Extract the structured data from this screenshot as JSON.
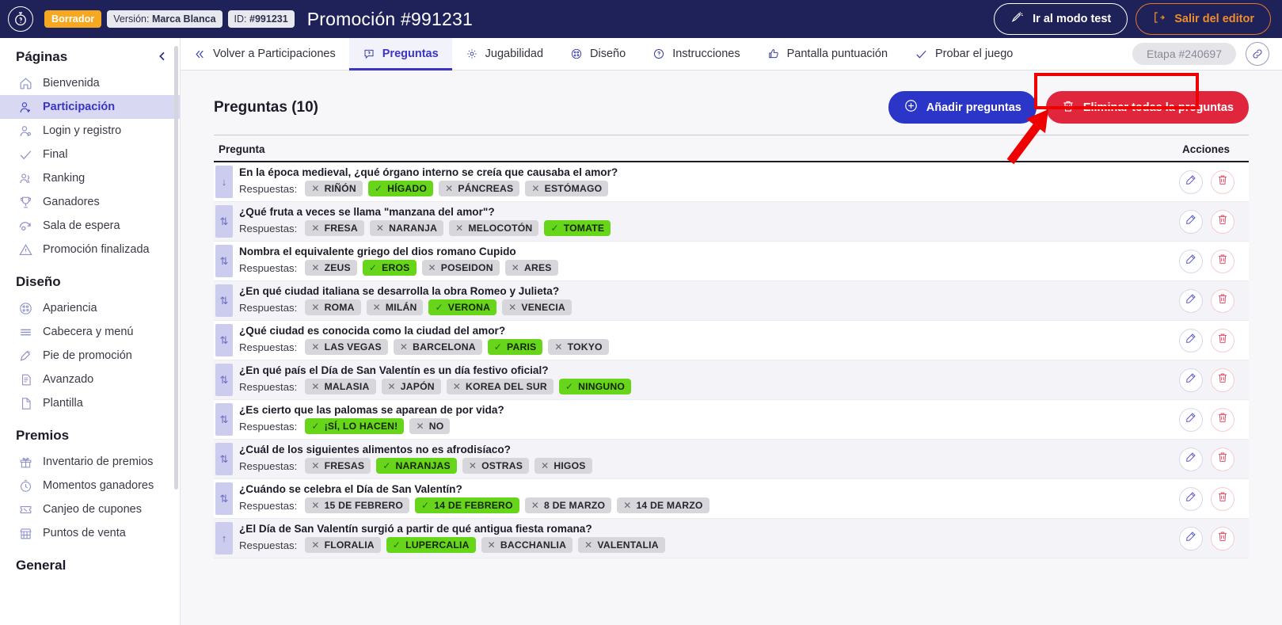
{
  "header": {
    "logo_icon": "stopwatch-question-icon",
    "status_badge": "Borrador",
    "version_label": "Versión:",
    "version_value": "Marca Blanca",
    "id_label": "ID:",
    "id_value": "#991231",
    "title": "Promoción #991231",
    "test_mode_button": "Ir al modo test",
    "exit_editor_button": "Salir del editor",
    "accent_draft": "#f6a821",
    "accent_exit": "#ef8c2e",
    "background": "#1f2159"
  },
  "sidebar": {
    "sections": [
      {
        "title": "Páginas",
        "items": [
          {
            "label": "Bienvenida",
            "icon": "home-icon",
            "active": false
          },
          {
            "label": "Participación",
            "icon": "user-plus-icon",
            "active": true
          },
          {
            "label": "Login y registro",
            "icon": "user-gear-icon",
            "active": false
          },
          {
            "label": "Final",
            "icon": "check-icon",
            "active": false
          },
          {
            "label": "Ranking",
            "icon": "users-icon",
            "active": false
          },
          {
            "label": "Ganadores",
            "icon": "trophy-icon",
            "active": false
          },
          {
            "label": "Sala de espera",
            "icon": "hourglass-clock-icon",
            "active": false
          },
          {
            "label": "Promoción finalizada",
            "icon": "warning-triangle-icon",
            "active": false
          }
        ]
      },
      {
        "title": "Diseño",
        "items": [
          {
            "label": "Apariencia",
            "icon": "palette-icon",
            "active": false
          },
          {
            "label": "Cabecera y menú",
            "icon": "menu-lines-icon",
            "active": false
          },
          {
            "label": "Pie de promoción",
            "icon": "footer-icon",
            "active": false
          },
          {
            "label": "Avanzado",
            "icon": "document-code-icon",
            "active": false
          },
          {
            "label": "Plantilla",
            "icon": "page-icon",
            "active": false
          }
        ]
      },
      {
        "title": "Premios",
        "items": [
          {
            "label": "Inventario de premios",
            "icon": "gift-icon",
            "active": false
          },
          {
            "label": "Momentos ganadores",
            "icon": "clock-icon",
            "active": false
          },
          {
            "label": "Canjeo de cupones",
            "icon": "coupon-icon",
            "active": false
          },
          {
            "label": "Puntos de venta",
            "icon": "store-icon",
            "active": false
          }
        ]
      },
      {
        "title": "General",
        "items": []
      }
    ],
    "collapse_icon": "chevron-left-icon"
  },
  "tabs": [
    {
      "label": "Volver a Participaciones",
      "icon": "chevron-double-left-icon",
      "active": false
    },
    {
      "label": "Preguntas",
      "icon": "question-bubble-icon",
      "active": true
    },
    {
      "label": "Jugabilidad",
      "icon": "gear-icon",
      "active": false
    },
    {
      "label": "Diseño",
      "icon": "palette-icon",
      "active": false
    },
    {
      "label": "Instrucciones",
      "icon": "question-circle-icon",
      "active": false
    },
    {
      "label": "Pantalla puntuación",
      "icon": "thumbs-up-icon",
      "active": false
    },
    {
      "label": "Probar el juego",
      "icon": "check-icon",
      "active": false
    }
  ],
  "tabbar_right": {
    "stage_pill": "Etapa #240697",
    "link_icon": "link-icon"
  },
  "toolbar": {
    "page_title": "Preguntas (10)",
    "add_button": "Añadir preguntas",
    "add_icon": "plus-circle-icon",
    "delete_all_button": "Eliminar todas la preguntas",
    "delete_all_icon": "trash-icon",
    "add_color": "#2b35c7",
    "delete_color": "#e0263c"
  },
  "table": {
    "col_question": "Pregunta",
    "col_actions": "Acciones",
    "answers_label": "Respuestas:",
    "edit_icon": "pencil-icon",
    "delete_icon": "trash-icon",
    "correct_mark": "✓",
    "wrong_mark": "✕",
    "correct_color": "#67d519",
    "rows": [
      {
        "handle": "↓",
        "question": "En la época medieval, ¿qué órgano interno se creía que causaba el amor?",
        "answers": [
          {
            "text": "RIÑÓN",
            "correct": false
          },
          {
            "text": "HÍGADO",
            "correct": true
          },
          {
            "text": "PÁNCREAS",
            "correct": false
          },
          {
            "text": "ESTÓMAGO",
            "correct": false
          }
        ]
      },
      {
        "handle": "⇅",
        "question": "¿Qué fruta a veces se llama \"manzana del amor\"?",
        "answers": [
          {
            "text": "FRESA",
            "correct": false
          },
          {
            "text": "NARANJA",
            "correct": false
          },
          {
            "text": "MELOCOTÓN",
            "correct": false
          },
          {
            "text": "TOMATE",
            "correct": true
          }
        ]
      },
      {
        "handle": "⇅",
        "question": "Nombra el equivalente griego del dios romano Cupido",
        "answers": [
          {
            "text": "ZEUS",
            "correct": false
          },
          {
            "text": "EROS",
            "correct": true
          },
          {
            "text": "POSEIDON",
            "correct": false
          },
          {
            "text": "ARES",
            "correct": false
          }
        ]
      },
      {
        "handle": "⇅",
        "question": "¿En qué ciudad italiana se desarrolla la obra Romeo y Julieta?",
        "answers": [
          {
            "text": "ROMA",
            "correct": false
          },
          {
            "text": "MILÁN",
            "correct": false
          },
          {
            "text": "VERONA",
            "correct": true
          },
          {
            "text": "VENECIA",
            "correct": false
          }
        ]
      },
      {
        "handle": "⇅",
        "question": "¿Qué ciudad es conocida como la ciudad del amor?",
        "answers": [
          {
            "text": "LAS VEGAS",
            "correct": false
          },
          {
            "text": "BARCELONA",
            "correct": false
          },
          {
            "text": "PARIS",
            "correct": true
          },
          {
            "text": "TOKYO",
            "correct": false
          }
        ]
      },
      {
        "handle": "⇅",
        "question": "¿En qué país el Día de San Valentín es un día festivo oficial?",
        "answers": [
          {
            "text": "MALASIA",
            "correct": false
          },
          {
            "text": "JAPÓN",
            "correct": false
          },
          {
            "text": "KOREA DEL SUR",
            "correct": false
          },
          {
            "text": "NINGUNO",
            "correct": true
          }
        ]
      },
      {
        "handle": "⇅",
        "question": "¿Es cierto que las palomas se aparean de por vida?",
        "answers": [
          {
            "text": "¡SÍ, LO HACEN!",
            "correct": true
          },
          {
            "text": "NO",
            "correct": false
          }
        ]
      },
      {
        "handle": "⇅",
        "question": "¿Cuál de los siguientes alimentos no es afrodisíaco?",
        "answers": [
          {
            "text": "FRESAS",
            "correct": false
          },
          {
            "text": "NARANJAS",
            "correct": true
          },
          {
            "text": "OSTRAS",
            "correct": false
          },
          {
            "text": "HIGOS",
            "correct": false
          }
        ]
      },
      {
        "handle": "⇅",
        "question": "¿Cuándo se celebra el Día de San Valentín?",
        "answers": [
          {
            "text": "15 DE FEBRERO",
            "correct": false
          },
          {
            "text": "14 DE FEBRERO",
            "correct": true
          },
          {
            "text": "8 DE MARZO",
            "correct": false
          },
          {
            "text": "14 DE MARZO",
            "correct": false
          }
        ]
      },
      {
        "handle": "↑",
        "question": "¿El Día de San Valentín surgió a partir de qué antigua fiesta romana?",
        "answers": [
          {
            "text": "FLORALIA",
            "correct": false
          },
          {
            "text": "LUPERCALIA",
            "correct": true
          },
          {
            "text": "BACCHANLIA",
            "correct": false
          },
          {
            "text": "VALENTALIA",
            "correct": false
          }
        ]
      }
    ]
  },
  "annotation": {
    "highlight_target": "Probar el juego",
    "color": "#ee0000"
  }
}
